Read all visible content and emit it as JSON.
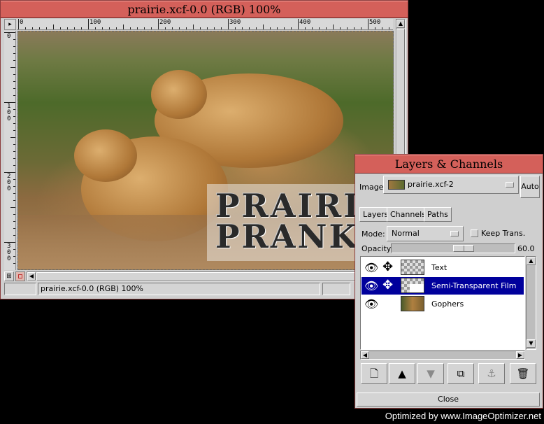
{
  "image_window": {
    "title": "prairie.xcf-0.0 (RGB) 100%",
    "status": "prairie.xcf-0.0 (RGB) 100%",
    "canvas_text_line1": "PRAIRIE",
    "canvas_text_line2": "PRANKS",
    "ruler_h_labels": [
      "0",
      "100",
      "200",
      "300",
      "400",
      "500"
    ],
    "ruler_v_labels": [
      "0",
      "100",
      "200",
      "300"
    ]
  },
  "layers_dialog": {
    "title": "Layers & Channels",
    "image_label": "Image:",
    "image_value": "prairie.xcf-2",
    "auto_label": "Auto",
    "tabs": [
      "Layers",
      "Channels",
      "Paths"
    ],
    "mode_label": "Mode:",
    "mode_value": "Normal",
    "keep_trans_label": "Keep Trans.",
    "opacity_label": "Opacity:",
    "opacity_value": "60.0",
    "opacity_fraction": 0.6,
    "layers": [
      {
        "name": "Text",
        "visible": true,
        "linked": true,
        "selected": false
      },
      {
        "name": "Semi-Transparent Film",
        "visible": true,
        "linked": true,
        "selected": true
      },
      {
        "name": "Gophers",
        "visible": true,
        "linked": false,
        "selected": false
      }
    ],
    "close_label": "Close"
  },
  "footer": "Optimized by www.ImageOptimizer.net",
  "colors": {
    "titlebar": "#d4605a",
    "selection": "#00009c"
  }
}
